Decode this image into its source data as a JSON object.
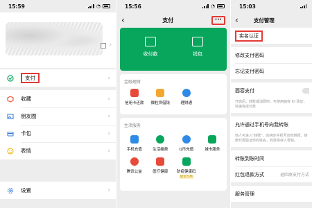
{
  "colors": {
    "accent_green": "#07a65c",
    "highlight_red": "#e53935",
    "bg_gray": "#ededed"
  },
  "screen1": {
    "time": "15:59",
    "menu": [
      {
        "label": "支付",
        "icon": "pay-check-icon",
        "highlighted": true
      },
      {
        "label": "收藏",
        "icon": "favorites-cube-icon"
      },
      {
        "label": "朋友圈",
        "icon": "moments-image-icon"
      },
      {
        "label": "卡包",
        "icon": "card-wallet-icon"
      },
      {
        "label": "表情",
        "icon": "emoji-icon"
      },
      {
        "label": "设置",
        "icon": "settings-gear-icon"
      }
    ]
  },
  "screen2": {
    "time": "15:56",
    "title": "支付",
    "more": "···",
    "pay_code": "收付款",
    "wallet": "钱包",
    "finance_title": "金融理财",
    "finance_items": [
      "信用卡还款",
      "微粒贷借钱",
      "理财通"
    ],
    "life_title": "生活服务",
    "life_items": [
      "手机充值",
      "生活缴费",
      "Q币充值",
      "城市服务",
      "腾讯公益",
      "医疗健康",
      "防疫健康码"
    ],
    "life_tag": "附近可用"
  },
  "screen3": {
    "time": "15:03",
    "title": "支付管理",
    "rows": [
      {
        "label": "实名认证",
        "highlighted": true
      },
      {
        "label": "修改支付密码"
      },
      {
        "label": "忘记支付密码"
      }
    ],
    "face_pay": "面容支付",
    "face_pay_desc": "开启后，转账或消费时，可使用面容 ID 验证，快速完成付款",
    "phone_transfer": "允许通过手机号向我转账",
    "phone_transfer_desc": "他人可进入\"转账\"，向绑定手机号向你转账，转账时需验证你的姓名，收款将存入零钱。",
    "arrival_time": "转账到账时间",
    "refund_method": "红包退款方式",
    "refund_value": "退回原支付方式",
    "service_mgmt": "服务管理"
  }
}
